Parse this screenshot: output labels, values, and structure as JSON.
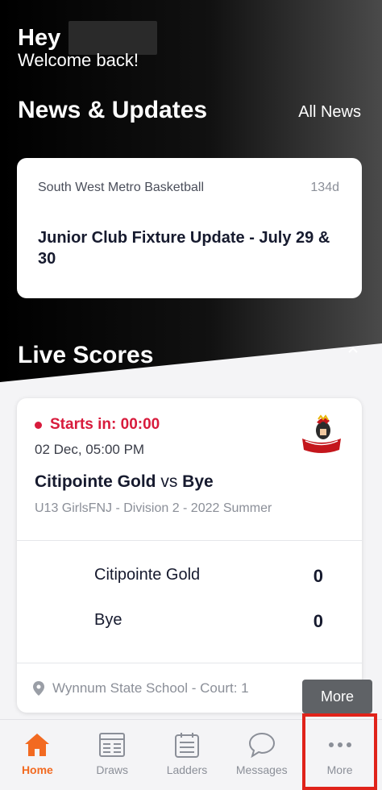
{
  "greeting": {
    "hey": "Hey",
    "welcome": "Welcome back!"
  },
  "news": {
    "title": "News & Updates",
    "all_news": "All News",
    "card": {
      "source": "South West Metro Basketball",
      "age": "134d",
      "headline": "Junior Club Fixture Update - July 29 & 30"
    }
  },
  "live": {
    "title": "Live Scores",
    "match": {
      "status": "Starts in: 00:00",
      "date": "02 Dec, 05:00 PM",
      "home": "Citipointe Gold",
      "vs": "vs",
      "away": "Bye",
      "division": "U13 GirlsFNJ - Division 2 - 2022 Summer",
      "teams": [
        {
          "name": "Citipointe Gold",
          "score": "0"
        },
        {
          "name": "Bye",
          "score": "0"
        }
      ],
      "venue": "Wynnum State School - Court: 1"
    }
  },
  "tooltip": {
    "more": "More"
  },
  "tabs": [
    {
      "label": "Home",
      "icon": "home-icon"
    },
    {
      "label": "Draws",
      "icon": "draws-icon"
    },
    {
      "label": "Ladders",
      "icon": "ladders-icon"
    },
    {
      "label": "Messages",
      "icon": "messages-icon"
    },
    {
      "label": "More",
      "icon": "more-dots-icon"
    }
  ],
  "colors": {
    "accent": "#f26a21",
    "live_red": "#d81b3c",
    "highlight": "#e0231a"
  }
}
